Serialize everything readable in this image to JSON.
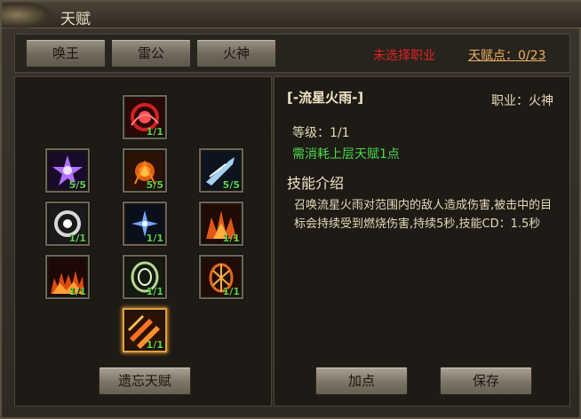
{
  "window": {
    "title": "天赋"
  },
  "tabs": [
    {
      "label": "唤王"
    },
    {
      "label": "雷公"
    },
    {
      "label": "火神"
    }
  ],
  "status": "未选择职业",
  "talent_points": "天赋点：0/23",
  "skills": [
    {
      "level": "1/1",
      "icon": "red-vortex-icon"
    },
    {
      "level": "5/5",
      "icon": "purple-star-icon"
    },
    {
      "level": "5/5",
      "icon": "fire-burst-icon"
    },
    {
      "level": "5/5",
      "icon": "ice-comet-icon"
    },
    {
      "level": "1/1",
      "icon": "white-vortex-icon"
    },
    {
      "level": "1/1",
      "icon": "blue-spark-icon"
    },
    {
      "level": "1/1",
      "icon": "flame-spikes-icon"
    },
    {
      "level": "1/1",
      "icon": "fire-wall-icon"
    },
    {
      "level": "1/1",
      "icon": "green-ring-icon"
    },
    {
      "level": "1/1",
      "icon": "fire-totem-icon"
    },
    {
      "level": "1/1",
      "icon": "meteor-shower-icon"
    }
  ],
  "buttons": {
    "forget": "遗忘天赋",
    "add_point": "加点",
    "save": "保存"
  },
  "detail": {
    "name": "[-流星火雨-]",
    "job": "职业：火神",
    "level": "等级：1/1",
    "requirement": "需消耗上层天赋1点",
    "intro_heading": "技能介绍",
    "description": "召唤流星火雨对范围内的敌人造成伤害,被击中的目标会持续受到燃烧伤害,持续5秒,技能CD：1.5秒"
  },
  "colors": {
    "status": "#e02323",
    "points": "#f0b060",
    "level_text": "#5cd24a",
    "requirement": "#4ad84a",
    "selected_border": "#e0a040"
  }
}
